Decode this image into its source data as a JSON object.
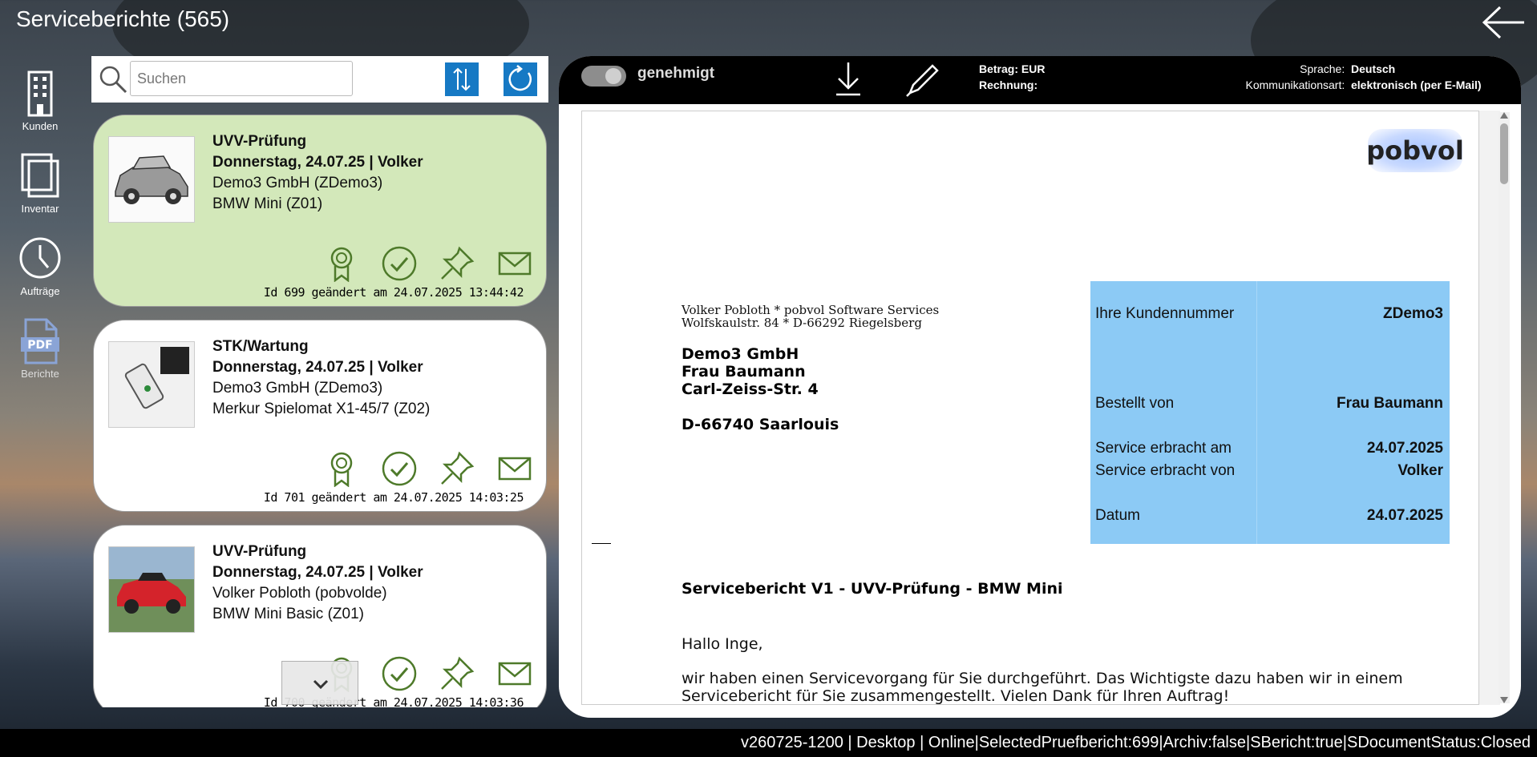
{
  "header": {
    "title": "Serviceberichte (565)"
  },
  "nav": {
    "items": [
      {
        "label": "Kunden",
        "icon": "building-icon"
      },
      {
        "label": "Inventar",
        "icon": "stack-icon"
      },
      {
        "label": "Aufträge",
        "icon": "clock-icon"
      },
      {
        "label": "Berichte",
        "icon": "pdf-icon"
      }
    ]
  },
  "search": {
    "placeholder": "Suchen",
    "value": ""
  },
  "cards": [
    {
      "title": "UVV-Prüfung",
      "date_line": "Donnerstag, 24.07.25 | Volker",
      "customer": "Demo3 GmbH (ZDemo3)",
      "object": "BMW Mini (Z01)",
      "footer": "Id 699 geändert am 24.07.2025 13:44:42",
      "selected": true
    },
    {
      "title": "STK/Wartung",
      "date_line": "Donnerstag, 24.07.25 | Volker",
      "customer": "Demo3 GmbH (ZDemo3)",
      "object": "Merkur Spielomat X1-45/7 (Z02)",
      "footer": "Id 701 geändert am 24.07.2025 14:03:25",
      "selected": false
    },
    {
      "title": "UVV-Prüfung",
      "date_line": "Donnerstag, 24.07.25 | Volker",
      "customer": "Volker Pobloth (pobvolde)",
      "object": "BMW Mini Basic (Z01)",
      "footer": "Id 700 geändert am 24.07.2025 14:03:36",
      "selected": false
    }
  ],
  "panel": {
    "toggle_label": "genehmigt",
    "betrag_label": "Betrag:",
    "betrag_value": "EUR",
    "rechnung_label": "Rechnung:",
    "rechnung_value": "",
    "sprache_label": "Sprache:",
    "sprache_value": "Deutsch",
    "kommunikation_label": "Kommunikationsart:",
    "kommunikation_value": "elektronisch (per E-Mail)"
  },
  "document": {
    "logo": "pobvol",
    "sender_line1": "Volker Pobloth * pobvol Software Services",
    "sender_line2": "Wolfskaulstr. 84 * D-66292 Riegelsberg",
    "recipient": [
      "Demo3 GmbH",
      "Frau Baumann",
      "Carl-Zeiss-Str. 4"
    ],
    "recipient_city": "D-66740 Saarlouis",
    "info": {
      "kundennummer_label": "Ihre Kundennummer",
      "kundennummer_value": "ZDemo3",
      "bestellt_label": "Bestellt von",
      "bestellt_value": "Frau Baumann",
      "erbracht_am_label": "Service erbracht am",
      "erbracht_am_value": "24.07.2025",
      "erbracht_von_label": "Service erbracht von",
      "erbracht_von_value": "Volker",
      "datum_label": "Datum",
      "datum_value": "24.07.2025"
    },
    "subject": "Servicebericht V1 - UVV-Prüfung - BMW Mini",
    "greeting": "Hallo Inge,",
    "body": "wir haben einen Servicevorgang für Sie durchgeführt. Das Wichtigste dazu haben wir in einem Servicebericht für Sie zusammengestellt. Vielen Dank für Ihren Auftrag!"
  },
  "statusbar": {
    "text": "v260725-1200 | Desktop | Online|SelectedPruefbericht:699|Archiv:false|SBericht:true|SDocumentStatus:Closed"
  }
}
